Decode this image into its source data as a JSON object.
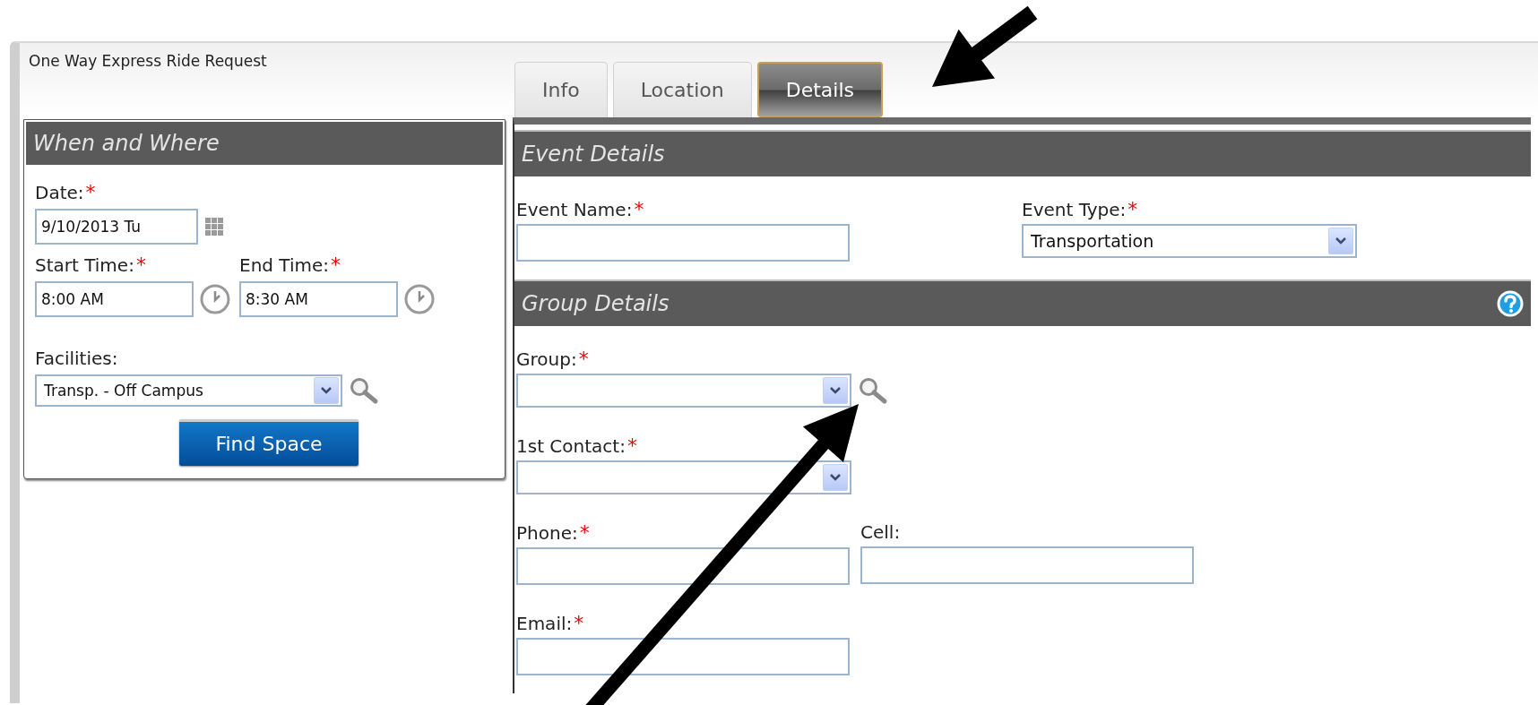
{
  "window": {
    "title": "One Way Express Ride Request"
  },
  "tabs": [
    {
      "label": "Info",
      "selected": false
    },
    {
      "label": "Location",
      "selected": false
    },
    {
      "label": "Details",
      "selected": true
    }
  ],
  "when_and_where": {
    "title": "When and Where",
    "rows": [
      [
        {
          "kind": "date",
          "label": "Date:",
          "required_mark": "*",
          "value": "9/10/2013 Tu"
        }
      ],
      [
        {
          "kind": "time",
          "label": "Start Time:",
          "required_mark": "*",
          "value": "8:00 AM"
        },
        {
          "kind": "time",
          "label": "End Time:",
          "required_mark": "*",
          "value": "8:30 AM"
        }
      ],
      [
        {
          "kind": "select",
          "label": "Facilities:",
          "value": "Transp. - Off Campus",
          "lookup": true
        }
      ]
    ],
    "button": "Find Space"
  },
  "sections": [
    {
      "title": "Event Details",
      "help": false,
      "rows": [
        [
          {
            "kind": "text",
            "label": "Event Name:",
            "required_mark": "*"
          },
          {
            "kind": "select",
            "label": "Event Type:",
            "required_mark": "*",
            "value": "Transportation"
          }
        ]
      ]
    },
    {
      "title": "Group Details",
      "help": true,
      "rows": [
        [
          {
            "kind": "select",
            "label": "Group:",
            "required_mark": "*",
            "lookup": true
          }
        ],
        [
          {
            "kind": "select",
            "label": "1st Contact:",
            "required_mark": "*"
          }
        ],
        [
          {
            "kind": "text",
            "label": "Phone:",
            "required_mark": "*"
          },
          {
            "kind": "text",
            "label": "Cell:"
          }
        ],
        [
          {
            "kind": "text",
            "label": "Email:",
            "required_mark": "*"
          }
        ]
      ]
    }
  ]
}
